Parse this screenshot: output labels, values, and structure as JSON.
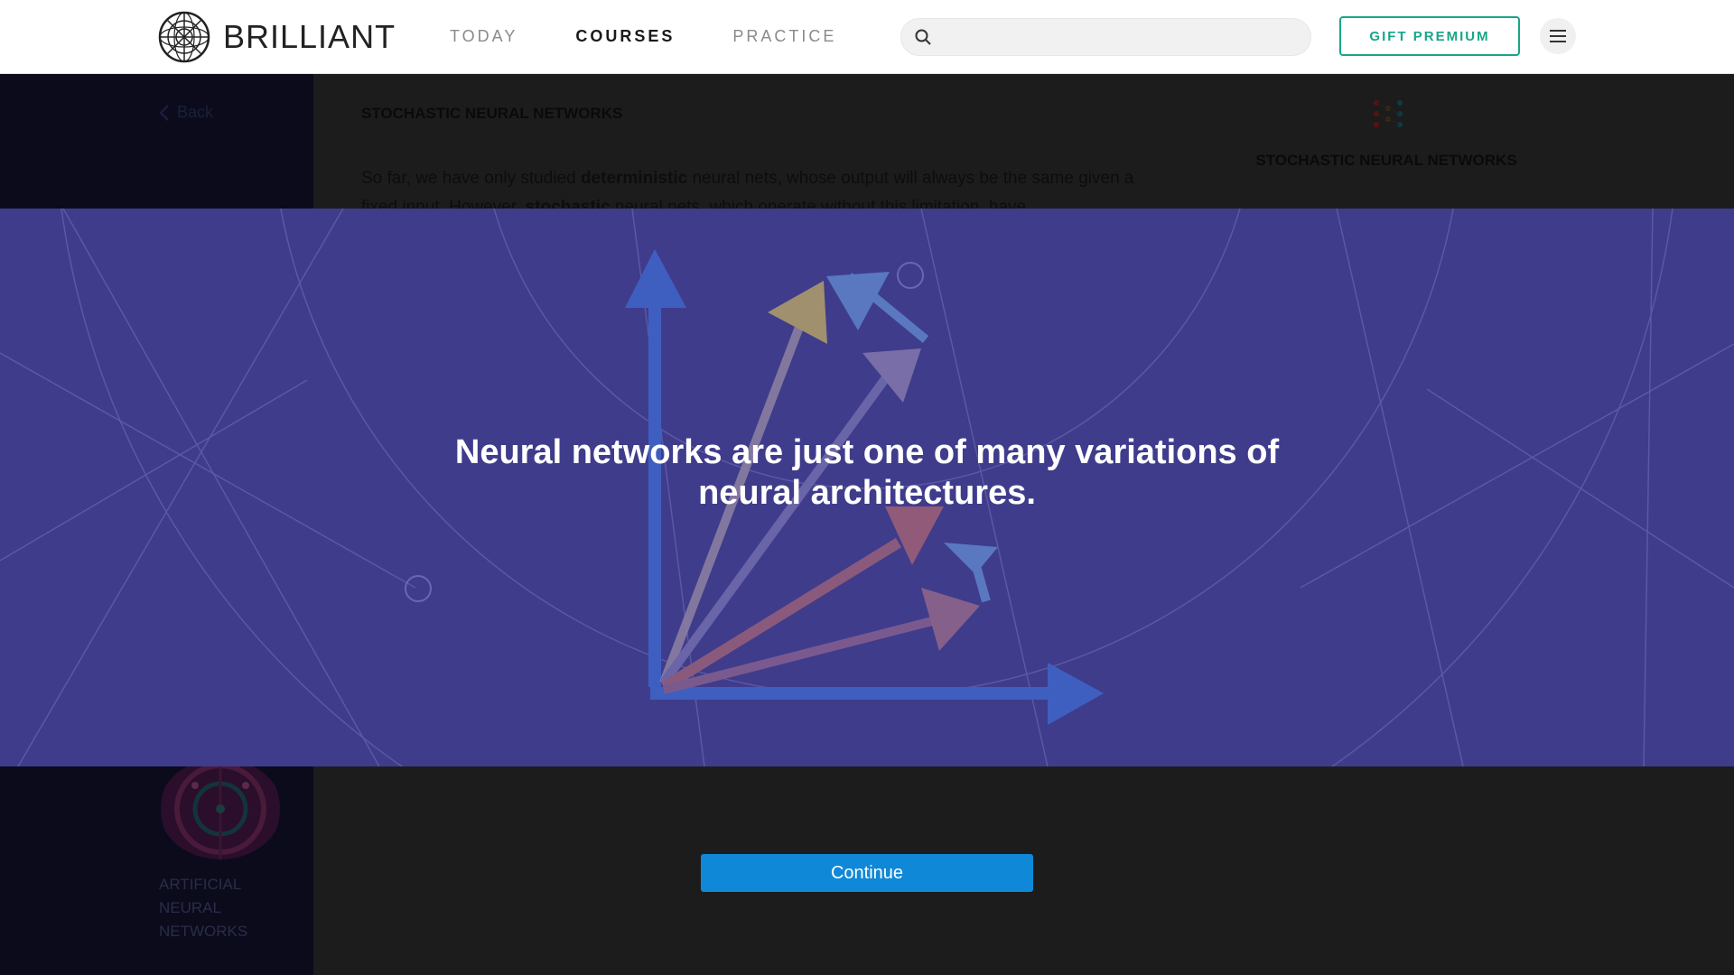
{
  "header": {
    "logo_text": "BRILLIANT",
    "nav": [
      {
        "label": "TODAY",
        "active": false
      },
      {
        "label": "COURSES",
        "active": true
      },
      {
        "label": "PRACTICE",
        "active": false
      }
    ],
    "search": {
      "placeholder": ""
    },
    "gift_label": "GIFT PREMIUM",
    "accent_color": "#18a688"
  },
  "sidebar": {
    "back_label": "Back",
    "course_name": "ARTIFICIAL NEURAL NETWORKS"
  },
  "lesson": {
    "title": "STOCHASTIC NEURAL NETWORKS",
    "para_a": "So far, we have only studied ",
    "para_b": "deterministic",
    "para_c": " neural nets, whose output will always be the same given a fixed input. However, ",
    "para_d": "stochastic",
    "para_e": " neural nets, which operate without this limitation, have",
    "right_title": "STOCHASTIC NEURAL NETWORKS"
  },
  "banner": {
    "message": "Neural networks are just one of many variations of neural architectures.",
    "color": "#3f3c8c"
  },
  "continue_label": "Continue",
  "continue_color": "#0f88d8"
}
